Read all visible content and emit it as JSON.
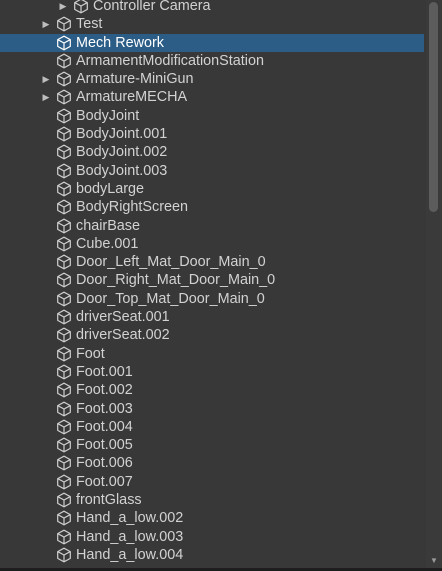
{
  "hierarchy": {
    "items": [
      {
        "label": "Controller Camera",
        "depth": 2,
        "expandable": true,
        "selected": false
      },
      {
        "label": "Test",
        "depth": 1,
        "expandable": true,
        "selected": false
      },
      {
        "label": "Mech Rework",
        "depth": 1,
        "expandable": false,
        "selected": true
      },
      {
        "label": "ArmamentModificationStation",
        "depth": 1,
        "expandable": false,
        "selected": false
      },
      {
        "label": "Armature-MiniGun",
        "depth": 1,
        "expandable": true,
        "selected": false
      },
      {
        "label": "ArmatureMECHA",
        "depth": 1,
        "expandable": true,
        "selected": false
      },
      {
        "label": "BodyJoint",
        "depth": 1,
        "expandable": false,
        "selected": false
      },
      {
        "label": "BodyJoint.001",
        "depth": 1,
        "expandable": false,
        "selected": false
      },
      {
        "label": "BodyJoint.002",
        "depth": 1,
        "expandable": false,
        "selected": false
      },
      {
        "label": "BodyJoint.003",
        "depth": 1,
        "expandable": false,
        "selected": false
      },
      {
        "label": "bodyLarge",
        "depth": 1,
        "expandable": false,
        "selected": false
      },
      {
        "label": "BodyRightScreen",
        "depth": 1,
        "expandable": false,
        "selected": false
      },
      {
        "label": "chairBase",
        "depth": 1,
        "expandable": false,
        "selected": false
      },
      {
        "label": "Cube.001",
        "depth": 1,
        "expandable": false,
        "selected": false
      },
      {
        "label": "Door_Left_Mat_Door_Main_0",
        "depth": 1,
        "expandable": false,
        "selected": false
      },
      {
        "label": "Door_Right_Mat_Door_Main_0",
        "depth": 1,
        "expandable": false,
        "selected": false
      },
      {
        "label": "Door_Top_Mat_Door_Main_0",
        "depth": 1,
        "expandable": false,
        "selected": false
      },
      {
        "label": "driverSeat.001",
        "depth": 1,
        "expandable": false,
        "selected": false
      },
      {
        "label": "driverSeat.002",
        "depth": 1,
        "expandable": false,
        "selected": false
      },
      {
        "label": "Foot",
        "depth": 1,
        "expandable": false,
        "selected": false
      },
      {
        "label": "Foot.001",
        "depth": 1,
        "expandable": false,
        "selected": false
      },
      {
        "label": "Foot.002",
        "depth": 1,
        "expandable": false,
        "selected": false
      },
      {
        "label": "Foot.003",
        "depth": 1,
        "expandable": false,
        "selected": false
      },
      {
        "label": "Foot.004",
        "depth": 1,
        "expandable": false,
        "selected": false
      },
      {
        "label": "Foot.005",
        "depth": 1,
        "expandable": false,
        "selected": false
      },
      {
        "label": "Foot.006",
        "depth": 1,
        "expandable": false,
        "selected": false
      },
      {
        "label": "Foot.007",
        "depth": 1,
        "expandable": false,
        "selected": false
      },
      {
        "label": "frontGlass",
        "depth": 1,
        "expandable": false,
        "selected": false
      },
      {
        "label": "Hand_a_low.002",
        "depth": 1,
        "expandable": false,
        "selected": false
      },
      {
        "label": "Hand_a_low.003",
        "depth": 1,
        "expandable": false,
        "selected": false
      },
      {
        "label": "Hand_a_low.004",
        "depth": 1,
        "expandable": false,
        "selected": false
      }
    ],
    "icons": {
      "expand": "triangle-right-icon",
      "object": "cube-icon",
      "scroll_down": "triangle-down-icon"
    },
    "glyphs": {
      "expand": "▶",
      "scroll_down": "▼"
    },
    "colors": {
      "background": "#383838",
      "text": "#d2d2d2",
      "selection": "#2c5d87",
      "selected_text": "#ffffff",
      "icon": "#cfcfcf"
    }
  }
}
